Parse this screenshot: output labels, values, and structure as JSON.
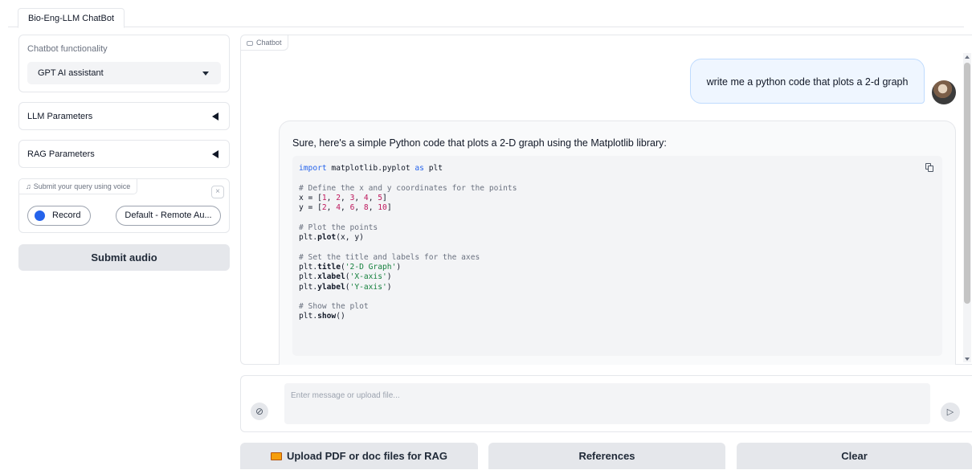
{
  "tabs": [
    {
      "label": "Bio-Eng-LLM ChatBot"
    }
  ],
  "sidebar": {
    "functionality": {
      "label": "Chatbot functionality",
      "selected": "GPT AI assistant"
    },
    "llm_parameters": {
      "label": "LLM Parameters"
    },
    "rag_parameters": {
      "label": "RAG Parameters"
    },
    "audio": {
      "label": "Submit your query using voice",
      "close_icon": "×",
      "record_label": "Record",
      "device_label": "Default - Remote Au..."
    },
    "submit_audio_label": "Submit audio"
  },
  "chat": {
    "label": "Chatbot",
    "user_message": "write me a python code that plots a 2-d graph",
    "bot_intro": "Sure, here's a simple Python code that plots a 2-D graph using the Matplotlib library:",
    "code_lines": [
      [
        {
          "t": "import",
          "c": "kw"
        },
        {
          "t": " matplotlib.pyplot "
        },
        {
          "t": "as",
          "c": "kw"
        },
        {
          "t": " plt"
        }
      ],
      [],
      [
        {
          "t": "# Define the x and y coordinates for the points",
          "c": "cmt"
        }
      ],
      [
        {
          "t": "x = ["
        },
        {
          "t": "1",
          "c": "num"
        },
        {
          "t": ", "
        },
        {
          "t": "2",
          "c": "num"
        },
        {
          "t": ", "
        },
        {
          "t": "3",
          "c": "num"
        },
        {
          "t": ", "
        },
        {
          "t": "4",
          "c": "num"
        },
        {
          "t": ", "
        },
        {
          "t": "5",
          "c": "num"
        },
        {
          "t": "]"
        }
      ],
      [
        {
          "t": "y = ["
        },
        {
          "t": "2",
          "c": "num"
        },
        {
          "t": ", "
        },
        {
          "t": "4",
          "c": "num"
        },
        {
          "t": ", "
        },
        {
          "t": "6",
          "c": "num"
        },
        {
          "t": ", "
        },
        {
          "t": "8",
          "c": "num"
        },
        {
          "t": ", "
        },
        {
          "t": "10",
          "c": "num"
        },
        {
          "t": "]"
        }
      ],
      [],
      [
        {
          "t": "# Plot the points",
          "c": "cmt"
        }
      ],
      [
        {
          "t": "plt."
        },
        {
          "t": "plot",
          "c": "fn"
        },
        {
          "t": "(x, y)"
        }
      ],
      [],
      [
        {
          "t": "# Set the title and labels for the axes",
          "c": "cmt"
        }
      ],
      [
        {
          "t": "plt."
        },
        {
          "t": "title",
          "c": "fn"
        },
        {
          "t": "("
        },
        {
          "t": "'2-D Graph'",
          "c": "str"
        },
        {
          "t": ")"
        }
      ],
      [
        {
          "t": "plt."
        },
        {
          "t": "xlabel",
          "c": "fn"
        },
        {
          "t": "("
        },
        {
          "t": "'X-axis'",
          "c": "str"
        },
        {
          "t": ")"
        }
      ],
      [
        {
          "t": "plt."
        },
        {
          "t": "ylabel",
          "c": "fn"
        },
        {
          "t": "("
        },
        {
          "t": "'Y-axis'",
          "c": "str"
        },
        {
          "t": ")"
        }
      ],
      [],
      [
        {
          "t": "# Show the plot",
          "c": "cmt"
        }
      ],
      [
        {
          "t": "plt."
        },
        {
          "t": "show",
          "c": "fn"
        },
        {
          "t": "()"
        }
      ]
    ]
  },
  "input": {
    "placeholder": "Enter message or upload file..."
  },
  "buttons": {
    "upload_label": "Upload PDF or doc files for RAG",
    "references_label": "References",
    "clear_label": "Clear"
  },
  "icons": {
    "attach": "paperclip-icon",
    "send": "send-icon",
    "copy": "copy-icon",
    "upload": "folder-icon",
    "music": "music-note-icon",
    "chat": "chat-icon"
  },
  "colors": {
    "accent": "#2563eb",
    "user_bubble": "#eff6ff",
    "button_bg": "#e5e7eb"
  }
}
